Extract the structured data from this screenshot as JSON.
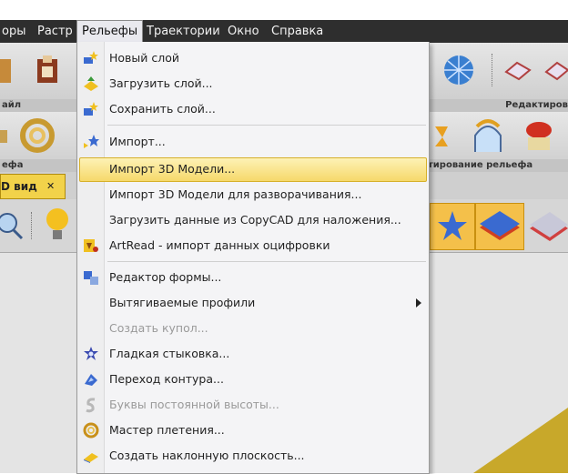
{
  "menubar": {
    "items": [
      "оры",
      "Растр",
      "Рельефы",
      "Траектории",
      "Окно",
      "Справка"
    ],
    "active_index": 2
  },
  "ribbon": {
    "group_left_label": "айл",
    "group_right_label": "Редактиров",
    "row2_left_label": "ефа",
    "row2_right_label": "тирование рельефа"
  },
  "document_tab": {
    "label": "D вид",
    "close": "✕"
  },
  "dropdown": {
    "items": [
      {
        "label": "Новый слой",
        "icon": "new-layer-icon",
        "enabled": true
      },
      {
        "label": "Загрузить слой...",
        "icon": "load-layer-icon",
        "enabled": true
      },
      {
        "label": "Сохранить слой...",
        "icon": "save-layer-icon",
        "enabled": true
      },
      {
        "label": "Импорт...",
        "icon": "import-icon",
        "enabled": true
      },
      {
        "label": "Импорт 3D Модели...",
        "icon": "",
        "enabled": true,
        "highlighted": true
      },
      {
        "label": "Импорт 3D Модели для разворачивания...",
        "icon": "",
        "enabled": true
      },
      {
        "label": "Загрузить данные из CopyCAD для наложения...",
        "icon": "",
        "enabled": true
      },
      {
        "label": "ArtRead - импорт данных оцифровки",
        "icon": "artread-icon",
        "enabled": true
      },
      {
        "label": "Редактор формы...",
        "icon": "shape-editor-icon",
        "enabled": true
      },
      {
        "label": "Вытягиваемые профили",
        "icon": "",
        "enabled": true,
        "submenu": true
      },
      {
        "label": "Создать купол...",
        "icon": "",
        "enabled": false
      },
      {
        "label": "Гладкая стыковка...",
        "icon": "smooth-join-icon",
        "enabled": true
      },
      {
        "label": "Переход контура...",
        "icon": "contour-transition-icon",
        "enabled": true
      },
      {
        "label": "Буквы постоянной высоты...",
        "icon": "constant-height-letters-icon",
        "enabled": false
      },
      {
        "label": "Мастер плетения...",
        "icon": "weave-wizard-icon",
        "enabled": true
      },
      {
        "label": "Создать наклонную плоскость...",
        "icon": "inclined-plane-icon",
        "enabled": true
      }
    ]
  },
  "colors": {
    "menubar_bg": "#2e2e2e",
    "highlight": "#f6d96a",
    "doc_tab": "#f2d24a"
  }
}
